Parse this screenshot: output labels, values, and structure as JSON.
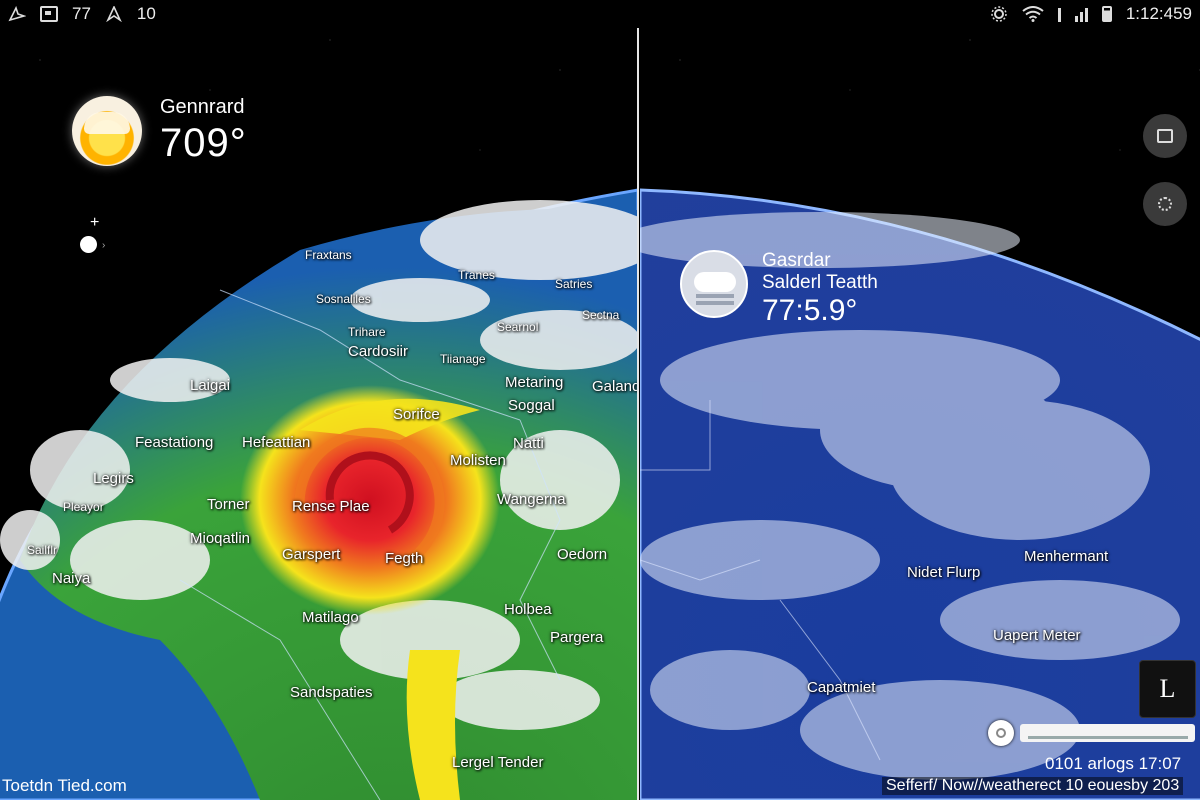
{
  "status_bar": {
    "left_items": [
      "77",
      "10"
    ],
    "time": "1:12:459"
  },
  "left_panel": {
    "location_name": "Gennrard",
    "temperature": "709°",
    "weather_icon": "sun-cloud-icon",
    "map_labels": [
      "Fraxtans",
      "Sosnaliles",
      "Tranes",
      "Satries",
      "Trihare",
      "Searnol",
      "Sectna",
      "Cardosiir",
      "Tiianage",
      "Laigai",
      "Metaring",
      "Galand",
      "Soggal",
      "Feastationg",
      "Hefeattian",
      "Sorifce",
      "Natti",
      "Legirs",
      "Molisten",
      "Pleayor",
      "Torner",
      "Rense Plae",
      "Wangerna",
      "Sailflr",
      "Mioqatlin",
      "Garspert",
      "Fegth",
      "Oedorn",
      "Naiya",
      "Matilago",
      "Holbea",
      "Pargera",
      "Sandspaties",
      "Lergel Tender"
    ],
    "footer": "Toetdn Tied.com"
  },
  "right_panel": {
    "location_name": "Gasrdar",
    "subtitle": "Salderl Teatth",
    "temperature": "77:5.9°",
    "weather_icon": "cloud-icon",
    "map_labels": [
      "Nidet Flurp",
      "Menhermant",
      "Uapert Meter",
      "Capatmiet"
    ],
    "legend_glyph": "L",
    "time_label": "0101 arlogs 17:07",
    "footer": "Sefferf/ Now//weatherect 10 eouesby 203"
  },
  "colors": {
    "storm_core": "#e8242b",
    "storm_band": "#f5e31c",
    "land_green": "#3aa33a",
    "ocean": "#1b5fb0"
  }
}
